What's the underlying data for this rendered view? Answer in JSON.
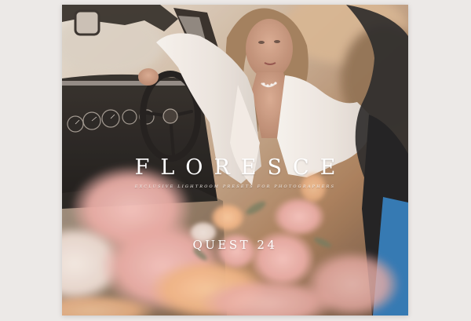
{
  "product": {
    "title": "FLORESCE",
    "subtitle": "EXCLUSIVE LIGHTROOM PRESETS FOR PHOTOGRAPHERS",
    "collection": "QUEST 24"
  },
  "colors": {
    "page_background": "#ece9e7",
    "text": "#ffffff",
    "flower_pink": "#e7a7a0",
    "flower_peach": "#efb07f"
  }
}
